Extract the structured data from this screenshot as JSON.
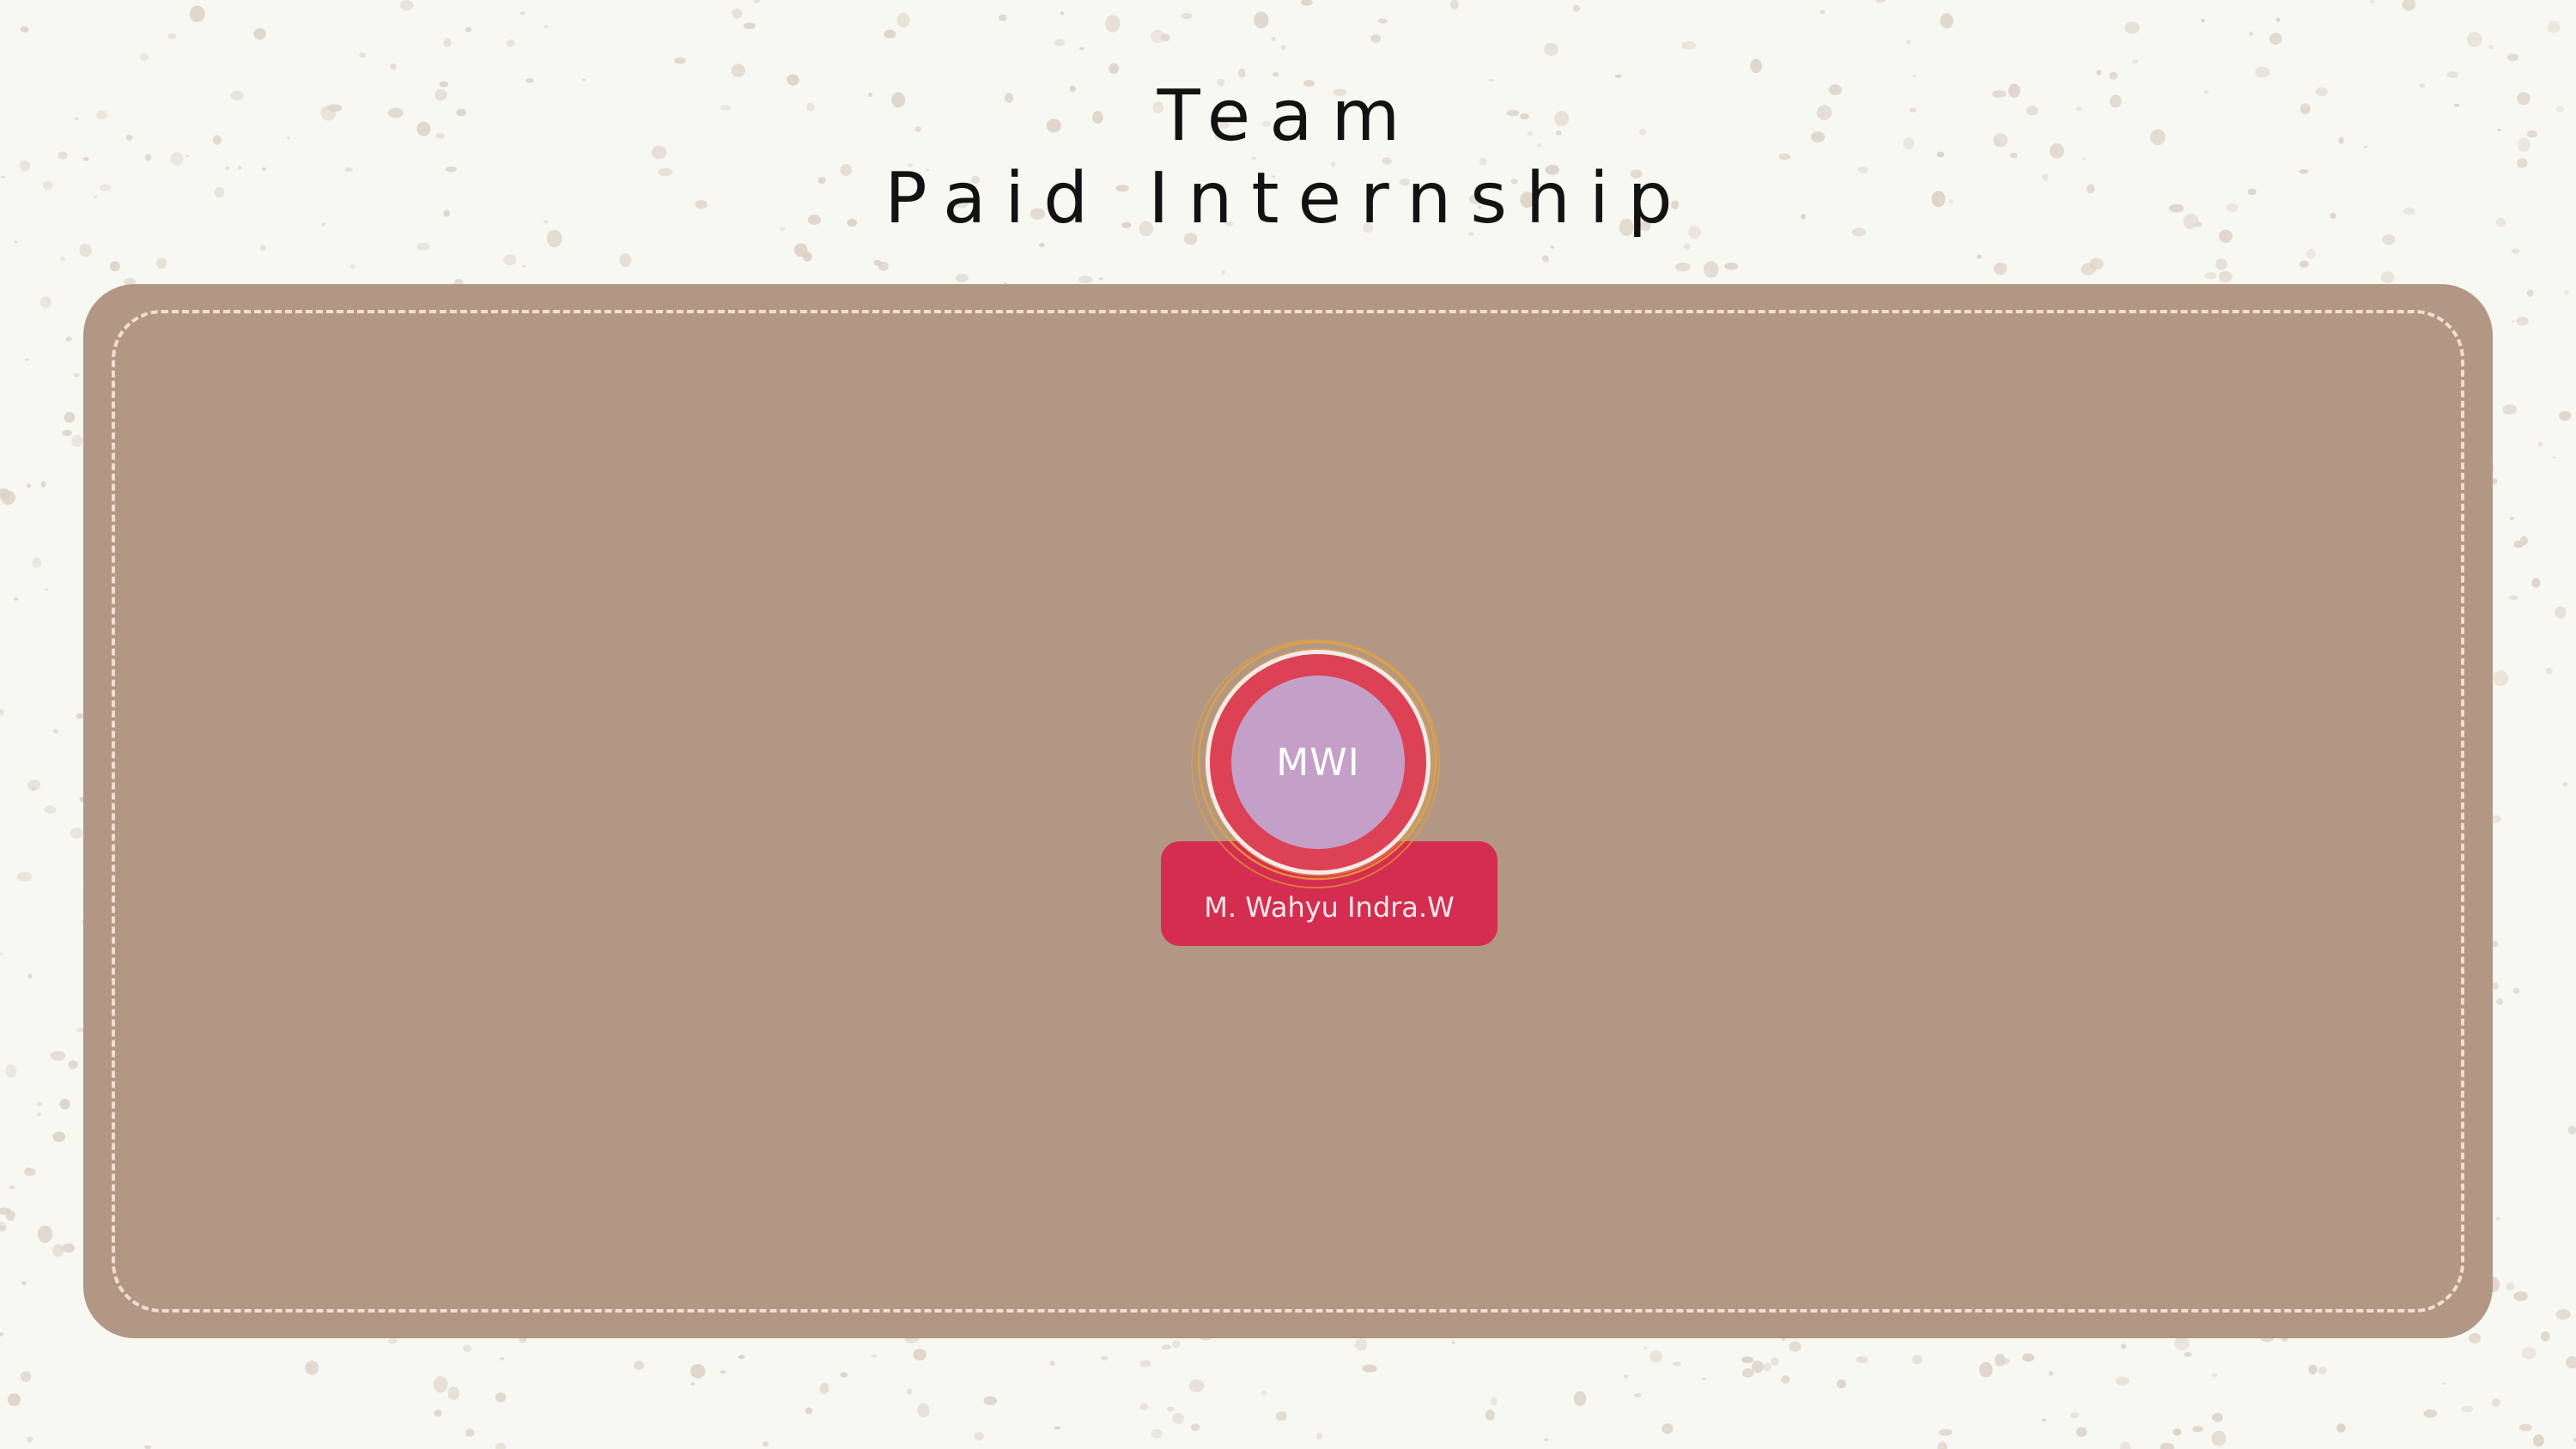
{
  "title": {
    "line1": "Team",
    "line2": "Paid Internship"
  },
  "team_member": {
    "initials": "MWI",
    "name": "M. Wahyu Indra.W"
  },
  "colors": {
    "background": "#f8f8f3",
    "board": "#b29784",
    "stitch": "#f1ddd0",
    "avatar_ring": "#dc4155",
    "avatar_fill": "#c4a0c8",
    "name_tag": "#d42d4f",
    "orbit": "#e8a43a",
    "speckle": "#ddd2c6"
  }
}
